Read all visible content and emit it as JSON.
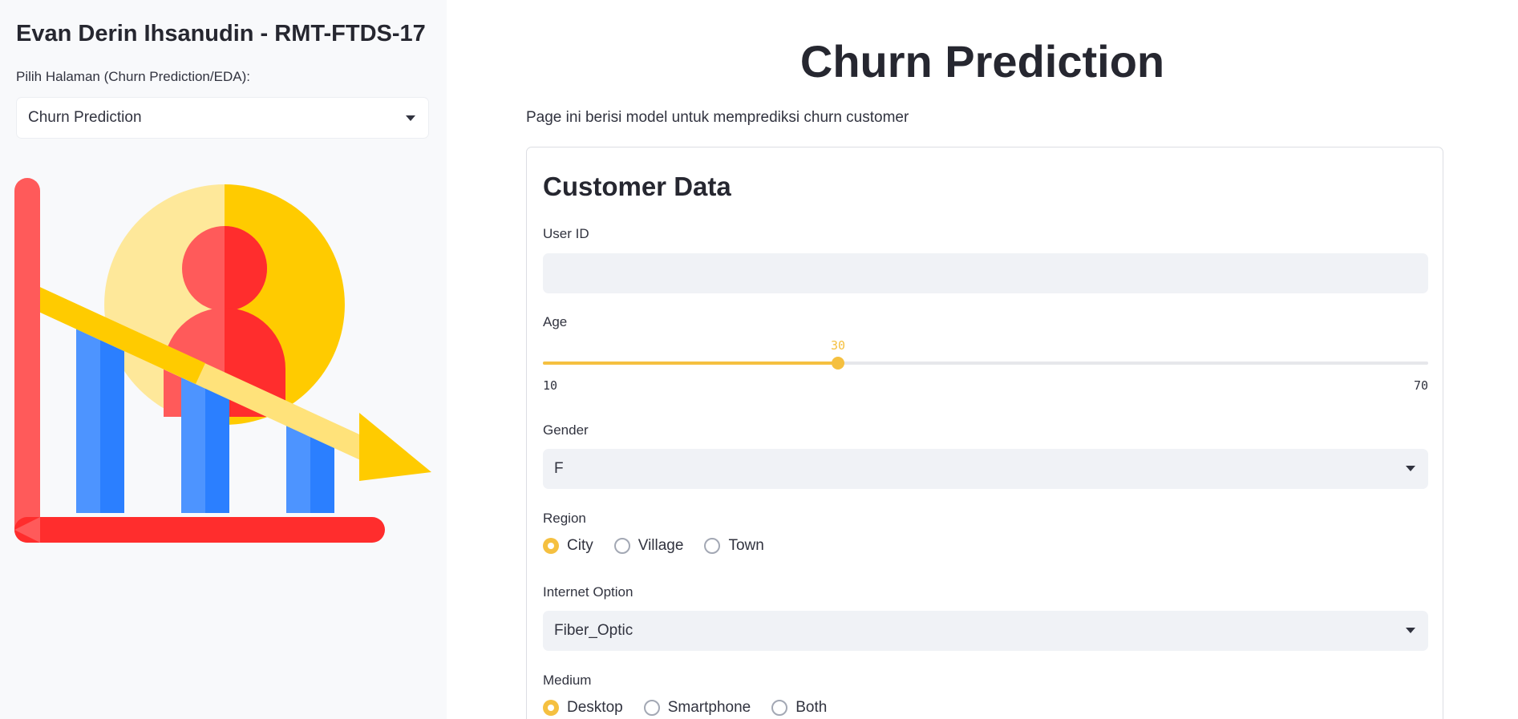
{
  "sidebar": {
    "title": "Evan Derin Ihsanudin - RMT-FTDS-17",
    "page_select_label": "Pilih Halaman (Churn Prediction/EDA):",
    "page_select_value": "Churn Prediction",
    "illustration_icon": "churn-decline-chart-icon"
  },
  "main": {
    "title": "Churn Prediction",
    "description": "Page ini berisi model untuk memprediksi churn customer",
    "form": {
      "title": "Customer Data",
      "user_id": {
        "label": "User ID",
        "value": "",
        "placeholder": ""
      },
      "age": {
        "label": "Age",
        "value": 30,
        "value_label": "30",
        "min": 10,
        "max": 70,
        "min_label": "10",
        "max_label": "70"
      },
      "gender": {
        "label": "Gender",
        "value": "F"
      },
      "region": {
        "label": "Region",
        "options": [
          "City",
          "Village",
          "Town"
        ],
        "selected": "City"
      },
      "internet_option": {
        "label": "Internet Option",
        "value": "Fiber_Optic"
      },
      "medium": {
        "label": "Medium",
        "options": [
          "Desktop",
          "Smartphone",
          "Both"
        ],
        "selected": "Desktop"
      }
    }
  },
  "colors": {
    "accent": "#f5c040",
    "sidebar_bg": "#f8f9fb",
    "input_bg": "#f0f2f6"
  }
}
